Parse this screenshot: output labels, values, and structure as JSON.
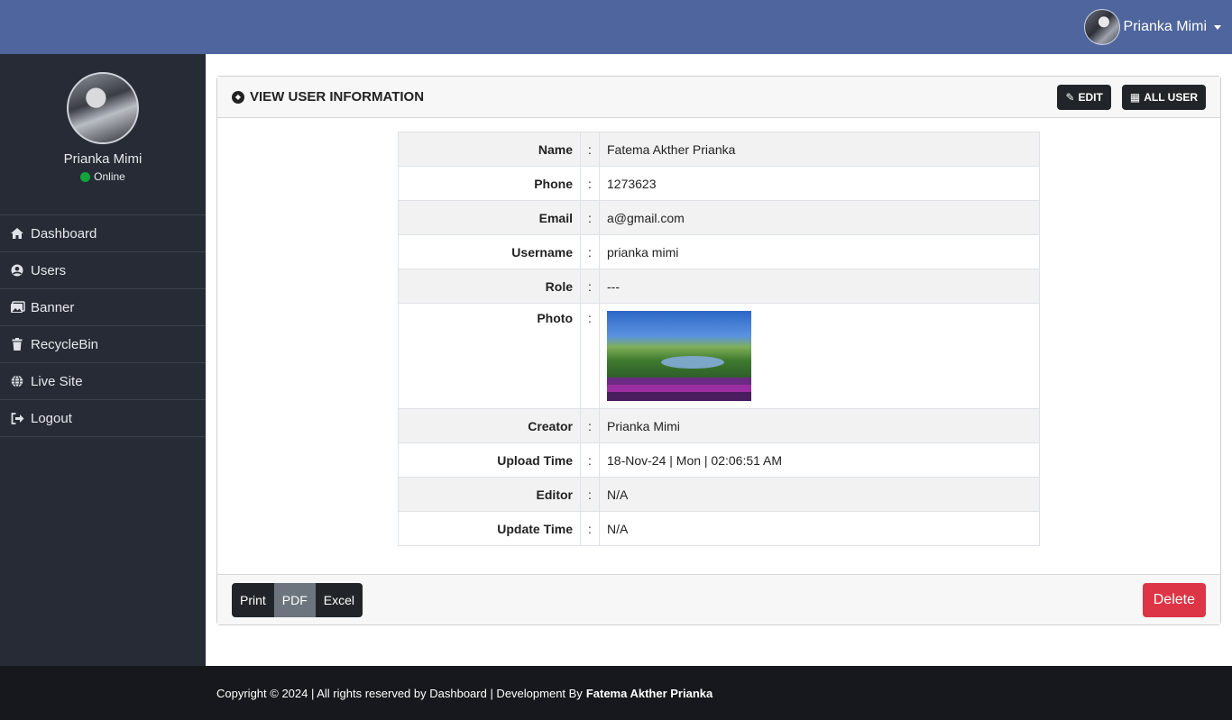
{
  "header": {
    "user_name": "Prianka Mimi"
  },
  "sidebar": {
    "profile_name": "Prianka Mimi",
    "status": "Online",
    "items": [
      {
        "label": "Dashboard",
        "icon": "home-icon"
      },
      {
        "label": "Users",
        "icon": "user-circle-icon"
      },
      {
        "label": "Banner",
        "icon": "images-icon"
      },
      {
        "label": "RecycleBin",
        "icon": "trash-icon"
      },
      {
        "label": "Live Site",
        "icon": "globe-icon"
      },
      {
        "label": "Logout",
        "icon": "sign-out-icon"
      }
    ]
  },
  "card": {
    "title": "VIEW USER INFORMATION",
    "edit_label": "EDIT",
    "all_user_label": "ALL USER",
    "separator": ":",
    "rows": [
      {
        "key": "Name",
        "value": "Fatema Akther Prianka"
      },
      {
        "key": "Phone",
        "value": "1273623"
      },
      {
        "key": "Email",
        "value": "a@gmail.com"
      },
      {
        "key": "Username",
        "value": "prianka mimi"
      },
      {
        "key": "Role",
        "value": "---"
      },
      {
        "key": "Photo",
        "value": ""
      },
      {
        "key": "Creator",
        "value": "Prianka Mimi"
      },
      {
        "key": "Upload Time",
        "value": "18-Nov-24 | Mon | 02:06:51 AM"
      },
      {
        "key": "Editor",
        "value": "N/A"
      },
      {
        "key": "Update Time",
        "value": "N/A"
      }
    ],
    "footer": {
      "print": "Print",
      "pdf": "PDF",
      "excel": "Excel",
      "delete": "Delete"
    }
  },
  "page_footer": {
    "text": "Copyright © 2024 | All rights reserved by Dashboard | Development By",
    "author": "Fatema Akther Prianka"
  },
  "colors": {
    "topbar": "#4e659d",
    "sidebar": "#262b35",
    "delete": "#dc3545",
    "status_online": "#12a33b"
  }
}
